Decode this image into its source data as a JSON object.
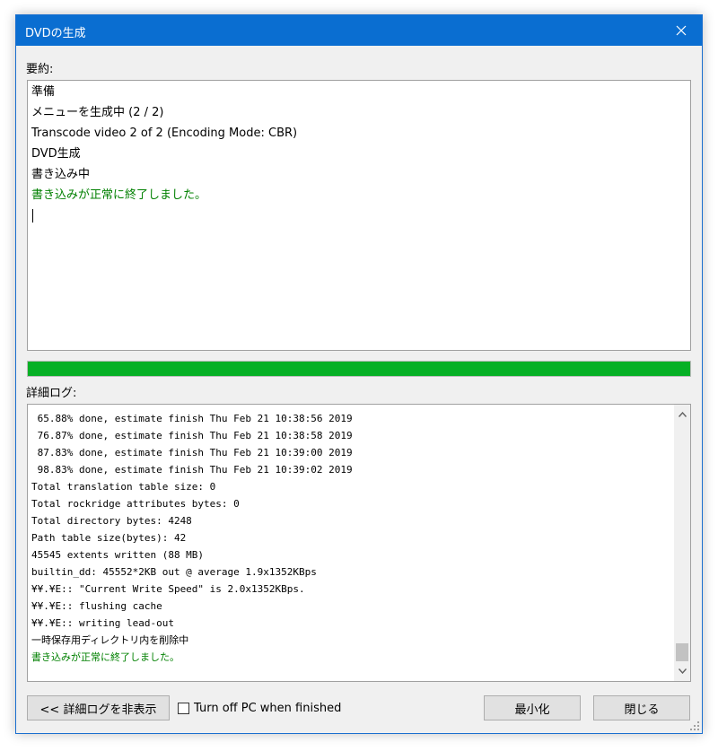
{
  "window": {
    "title": "DVDの生成",
    "close_label": "✕"
  },
  "summary": {
    "label": "要約:",
    "lines": [
      "準備",
      "メニューを生成中 (2 / 2)",
      "Transcode video 2 of 2 (Encoding Mode: CBR)",
      "DVD生成",
      "書き込み中",
      "書き込みが正常に終了しました。"
    ]
  },
  "progress": {
    "fraction": 1.0,
    "color": "#06b025"
  },
  "log": {
    "label": "詳細ログ:",
    "lines": [
      " 65.88% done, estimate finish Thu Feb 21 10:38:56 2019",
      " 76.87% done, estimate finish Thu Feb 21 10:38:58 2019",
      " 87.83% done, estimate finish Thu Feb 21 10:39:00 2019",
      " 98.83% done, estimate finish Thu Feb 21 10:39:02 2019",
      "Total translation table size: 0",
      "Total rockridge attributes bytes: 0",
      "Total directory bytes: 4248",
      "Path table size(bytes): 42",
      "45545 extents written (88 MB)",
      "builtin_dd: 45552*2KB out @ average 1.9x1352KBps",
      "¥¥.¥E:: \"Current Write Speed\" is 2.0x1352KBps.",
      "¥¥.¥E:: flushing cache",
      "¥¥.¥E:: writing lead-out",
      "一時保存用ディレクトリ内を削除中",
      "書き込みが正常に終了しました。"
    ]
  },
  "footer": {
    "hide_log_button": "<< 詳細ログを非表示",
    "checkbox_label": "Turn off PC when finished",
    "checkbox_checked": false,
    "minimize_button": "最小化",
    "close_button": "閉じる"
  },
  "colors": {
    "titlebar": "#0a6ed1",
    "success_text": "#008000"
  }
}
